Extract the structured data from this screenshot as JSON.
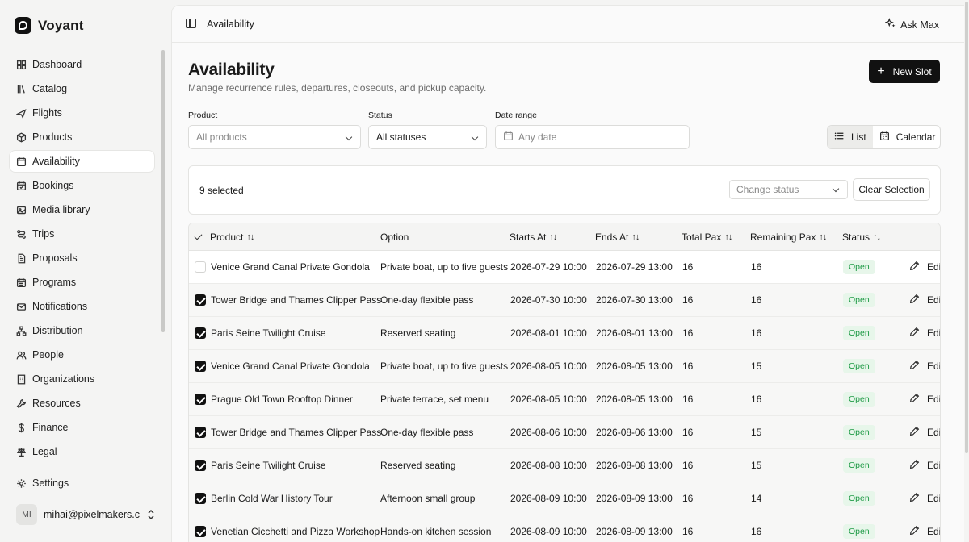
{
  "app": {
    "name": "Voyant"
  },
  "sidebar": {
    "items": [
      {
        "label": "Dashboard",
        "icon": "dashboard-icon"
      },
      {
        "label": "Catalog",
        "icon": "catalog-icon"
      },
      {
        "label": "Flights",
        "icon": "plane-icon"
      },
      {
        "label": "Products",
        "icon": "box-icon"
      },
      {
        "label": "Availability",
        "icon": "calendar-icon",
        "active": true
      },
      {
        "label": "Bookings",
        "icon": "calendar-check-icon"
      },
      {
        "label": "Media library",
        "icon": "image-icon"
      },
      {
        "label": "Trips",
        "icon": "route-icon"
      },
      {
        "label": "Proposals",
        "icon": "document-icon"
      },
      {
        "label": "Programs",
        "icon": "calendar-grid-icon"
      },
      {
        "label": "Notifications",
        "icon": "mail-icon"
      },
      {
        "label": "Distribution",
        "icon": "network-icon"
      },
      {
        "label": "People",
        "icon": "users-icon"
      },
      {
        "label": "Organizations",
        "icon": "building-icon"
      },
      {
        "label": "Resources",
        "icon": "wrench-icon"
      },
      {
        "label": "Finance",
        "icon": "dollar-icon"
      },
      {
        "label": "Legal",
        "icon": "scale-icon"
      }
    ],
    "settings": "Settings",
    "user": {
      "initials": "MI",
      "email": "mihai@pixelmakers.c..."
    }
  },
  "topbar": {
    "breadcrumb": "Availability",
    "ask": "Ask Max"
  },
  "page": {
    "title": "Availability",
    "subtitle": "Manage recurrence rules, departures, closeouts, and pickup capacity.",
    "new_slot": "New Slot"
  },
  "filters": {
    "product_label": "Product",
    "product_value": "All products",
    "status_label": "Status",
    "status_value": "All statuses",
    "date_label": "Date range",
    "date_placeholder": "Any date",
    "view_list": "List",
    "view_calendar": "Calendar"
  },
  "selection": {
    "count": "9 selected",
    "change_status": "Change status",
    "clear": "Clear Selection"
  },
  "table": {
    "columns": [
      "Product",
      "Option",
      "Starts At",
      "Ends At",
      "Total Pax",
      "Remaining Pax",
      "Status"
    ],
    "edit_label": "Edit",
    "rows": [
      {
        "checked": false,
        "product": "Venice Grand Canal Private Gondola",
        "option": "Private boat, up to five guests",
        "start": "2026-07-29 10:00",
        "end": "2026-07-29 13:00",
        "total": "16",
        "remaining": "16",
        "status": "Open"
      },
      {
        "checked": true,
        "product": "Tower Bridge and Thames Clipper Pass",
        "option": "One-day flexible pass",
        "start": "2026-07-30 10:00",
        "end": "2026-07-30 13:00",
        "total": "16",
        "remaining": "16",
        "status": "Open"
      },
      {
        "checked": true,
        "product": "Paris Seine Twilight Cruise",
        "option": "Reserved seating",
        "start": "2026-08-01 10:00",
        "end": "2026-08-01 13:00",
        "total": "16",
        "remaining": "16",
        "status": "Open"
      },
      {
        "checked": true,
        "product": "Venice Grand Canal Private Gondola",
        "option": "Private boat, up to five guests",
        "start": "2026-08-05 10:00",
        "end": "2026-08-05 13:00",
        "total": "16",
        "remaining": "15",
        "status": "Open"
      },
      {
        "checked": true,
        "product": "Prague Old Town Rooftop Dinner",
        "option": "Private terrace, set menu",
        "start": "2026-08-05 10:00",
        "end": "2026-08-05 13:00",
        "total": "16",
        "remaining": "16",
        "status": "Open"
      },
      {
        "checked": true,
        "product": "Tower Bridge and Thames Clipper Pass",
        "option": "One-day flexible pass",
        "start": "2026-08-06 10:00",
        "end": "2026-08-06 13:00",
        "total": "16",
        "remaining": "15",
        "status": "Open"
      },
      {
        "checked": true,
        "product": "Paris Seine Twilight Cruise",
        "option": "Reserved seating",
        "start": "2026-08-08 10:00",
        "end": "2026-08-08 13:00",
        "total": "16",
        "remaining": "15",
        "status": "Open"
      },
      {
        "checked": true,
        "product": "Berlin Cold War History Tour",
        "option": "Afternoon small group",
        "start": "2026-08-09 10:00",
        "end": "2026-08-09 13:00",
        "total": "16",
        "remaining": "14",
        "status": "Open"
      },
      {
        "checked": true,
        "product": "Venetian Cicchetti and Pizza Workshop",
        "option": "Hands-on kitchen session",
        "start": "2026-08-09 10:00",
        "end": "2026-08-09 13:00",
        "total": "16",
        "remaining": "16",
        "status": "Open"
      }
    ]
  }
}
